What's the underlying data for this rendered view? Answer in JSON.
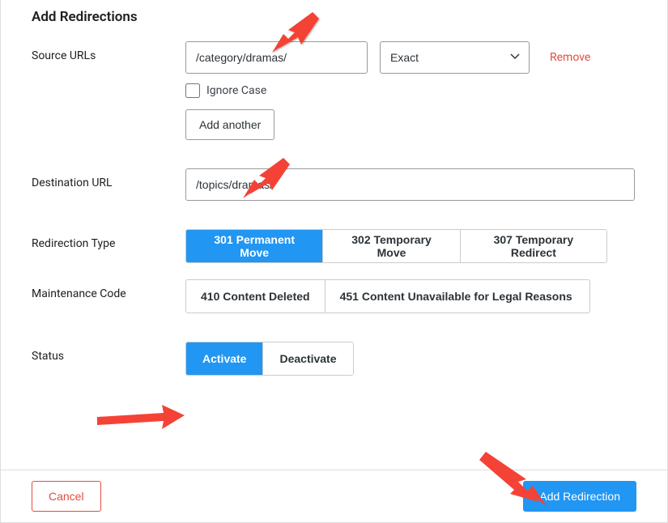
{
  "heading": "Add Redirections",
  "labels": {
    "source_urls": "Source URLs",
    "destination_url": "Destination URL",
    "redirection_type": "Redirection Type",
    "maintenance_code": "Maintenance Code",
    "status": "Status"
  },
  "source": {
    "url_value": "/category/dramas/",
    "match_selected": "Exact",
    "remove_link": "Remove",
    "ignore_case_label": "Ignore Case",
    "add_another": "Add another"
  },
  "destination": {
    "url_value": "/topics/dramas/"
  },
  "redirection_types": {
    "option1": "301 Permanent Move",
    "option2": "302 Temporary Move",
    "option3": "307 Temporary Redirect"
  },
  "maintenance_codes": {
    "option1": "410 Content Deleted",
    "option2": "451 Content Unavailable for Legal Reasons"
  },
  "status_options": {
    "activate": "Activate",
    "deactivate": "Deactivate"
  },
  "footer": {
    "cancel": "Cancel",
    "submit": "Add Redirection"
  }
}
